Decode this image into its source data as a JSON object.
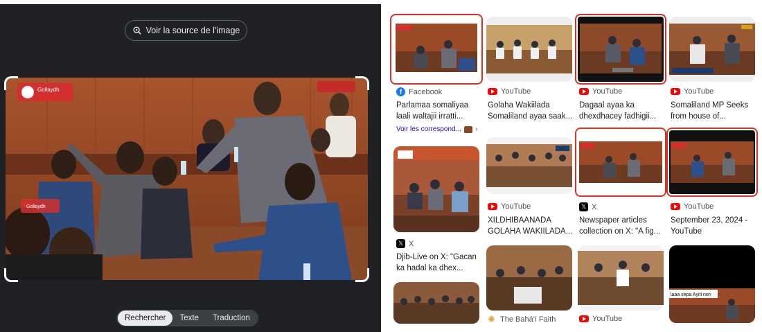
{
  "left_panel": {
    "source_button": "Voir la source de l'image",
    "tabs": [
      "Rechercher",
      "Texte",
      "Traduction"
    ],
    "active_tab": 0,
    "photo_watermark": "Gollaydh",
    "photo_badge": "Gollaydh"
  },
  "results": [
    {
      "source": "Facebook",
      "icon": "facebook-icon",
      "title": "Parlamaa somaliyaa laali waltajii irratti...",
      "highlighted": true
    },
    {
      "source": "YouTube",
      "icon": "youtube-icon",
      "title": "Golaha Wakiilada Somaliland ayaa saak...",
      "highlighted": false
    },
    {
      "source": "YouTube",
      "icon": "youtube-icon",
      "title": "Dagaal ayaa ka dhexdhacey fadhigii...",
      "highlighted": true
    },
    {
      "source": "YouTube",
      "icon": "youtube-icon",
      "title": "Somaliland MP Seeks from house of...",
      "highlighted": false
    },
    {
      "source": "X",
      "icon": "x-icon",
      "title": "Djib-Live on X: \"Gacan ka hadal ka dhex...",
      "highlighted": false
    },
    {
      "source": "YouTube",
      "icon": "youtube-icon",
      "title": "XILDHIBAANADA GOLAHA WAKIILADA...",
      "highlighted": false
    },
    {
      "source": "X",
      "icon": "x-icon",
      "title": "Newspaper articles collection on X: \"A fig...",
      "highlighted": true
    },
    {
      "source": "YouTube",
      "icon": "youtube-icon",
      "title": "September 23, 2024 - YouTube",
      "highlighted": true
    },
    {
      "source": "The Bahá'í Faith",
      "icon": "bahai-icon",
      "title": "",
      "highlighted": false
    },
    {
      "source": "YouTube",
      "icon": "youtube-icon",
      "title": "",
      "highlighted": false
    }
  ],
  "more_link": "Voir les correspond...",
  "thumb_caption_last": "laaa sepa Ayiti non",
  "colors": {
    "highlight": "#d93025",
    "youtube": "#ff0000",
    "facebook": "#1877f2",
    "panel_dark": "#202124"
  }
}
